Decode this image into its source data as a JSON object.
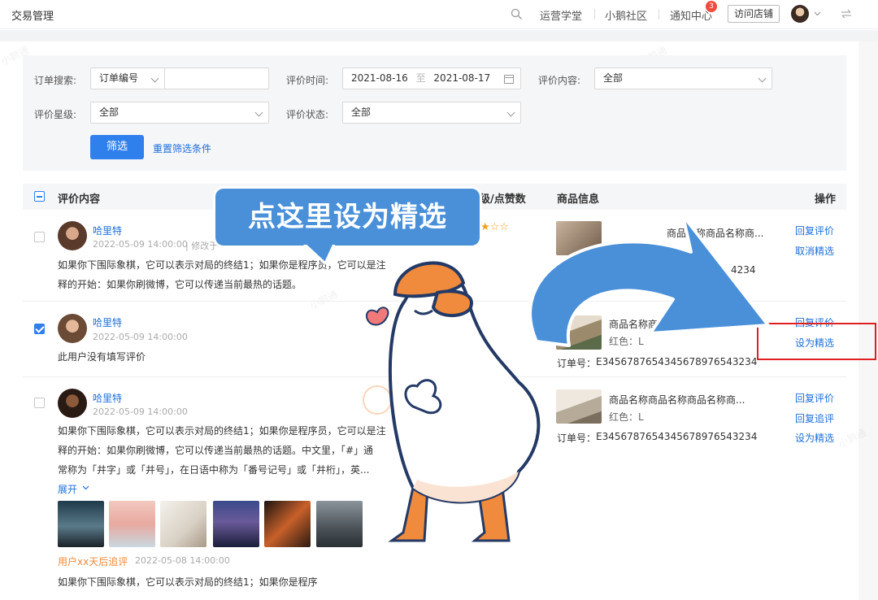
{
  "topbar": {
    "title": "交易管理",
    "nav": [
      "运营学堂",
      "小鹅社区",
      "通知中心"
    ],
    "notify_badge": "3",
    "visit_button": "访问店铺"
  },
  "filters": {
    "order_search_label": "订单搜索:",
    "order_type": "订单编号",
    "order_input": "",
    "review_time_label": "评价时间:",
    "date_start": "2021-08-16",
    "date_to": "至",
    "date_end": "2021-08-17",
    "review_content_label": "评价内容:",
    "review_content_value": "全部",
    "rating_label": "评价星级:",
    "rating_value": "全部",
    "status_label": "评价状态:",
    "status_value": "全部",
    "filter_button": "筛选",
    "reset_link": "重置筛选条件"
  },
  "table": {
    "col_review": "评价内容",
    "col_rating": "级/点赞数",
    "col_product": "商品信息",
    "col_ops": "操作"
  },
  "rows": [
    {
      "name": "哈里特",
      "time": "2022-05-09 14:00:00",
      "time_extra": "| 修改于",
      "text1": "如果你下围际象棋，它可以表示对局的终结1；如果你是程序员，它可以是注",
      "text2": "释的开始：如果你刷微博，它可以传递当前最热的话题。",
      "product_name": "商品名称商品名称商...",
      "order_no": "4234",
      "ops": [
        "回复评价",
        "取消精选"
      ]
    },
    {
      "name": "哈里特",
      "time": "2022-05-09 14:00:00",
      "text1": "此用户没有填写评价",
      "product_name": "商品名称商",
      "product_color": "红色：L",
      "order_label": "订单号：",
      "order_no": "E3456787654345678976543234",
      "ops": [
        "回复评价",
        "设为精选"
      ]
    },
    {
      "name": "哈里特",
      "time": "2022-05-09 14:00:00",
      "text1": "如果你下围际象棋，它可以表示对局的终结1；如果你是程序员，它可以是注",
      "text2": "释的开始：如果你刷微博，它可以传递当前最热的话题。中文里，「#」通",
      "text3": "常称为「井字」或「井号」，在日语中称为「番号记号」或「井桁」，英...",
      "expand": "展开",
      "followup_label": "用户xx天后追评",
      "followup_time": "2022-05-08 14:00:00",
      "followup_text": "如果你下围际象棋，它可以表示对局的终结1；如果你是程序",
      "product_name": "商品名称商品名称商品名称商...",
      "product_color": "红色：L",
      "order_label": "订单号：",
      "order_no": "E3456787654345678976543234",
      "ops": [
        "回复评价",
        "回复追评",
        "设为精选"
      ]
    }
  ],
  "callout": "点这里设为精选",
  "watermark": "小鹅通",
  "colors": {
    "accent": "#2f80ed",
    "link": "#1e6fd9",
    "callout_bg": "#4a90d9",
    "highlight_box": "#e02020",
    "mascot_orange": "#f08a3c"
  }
}
